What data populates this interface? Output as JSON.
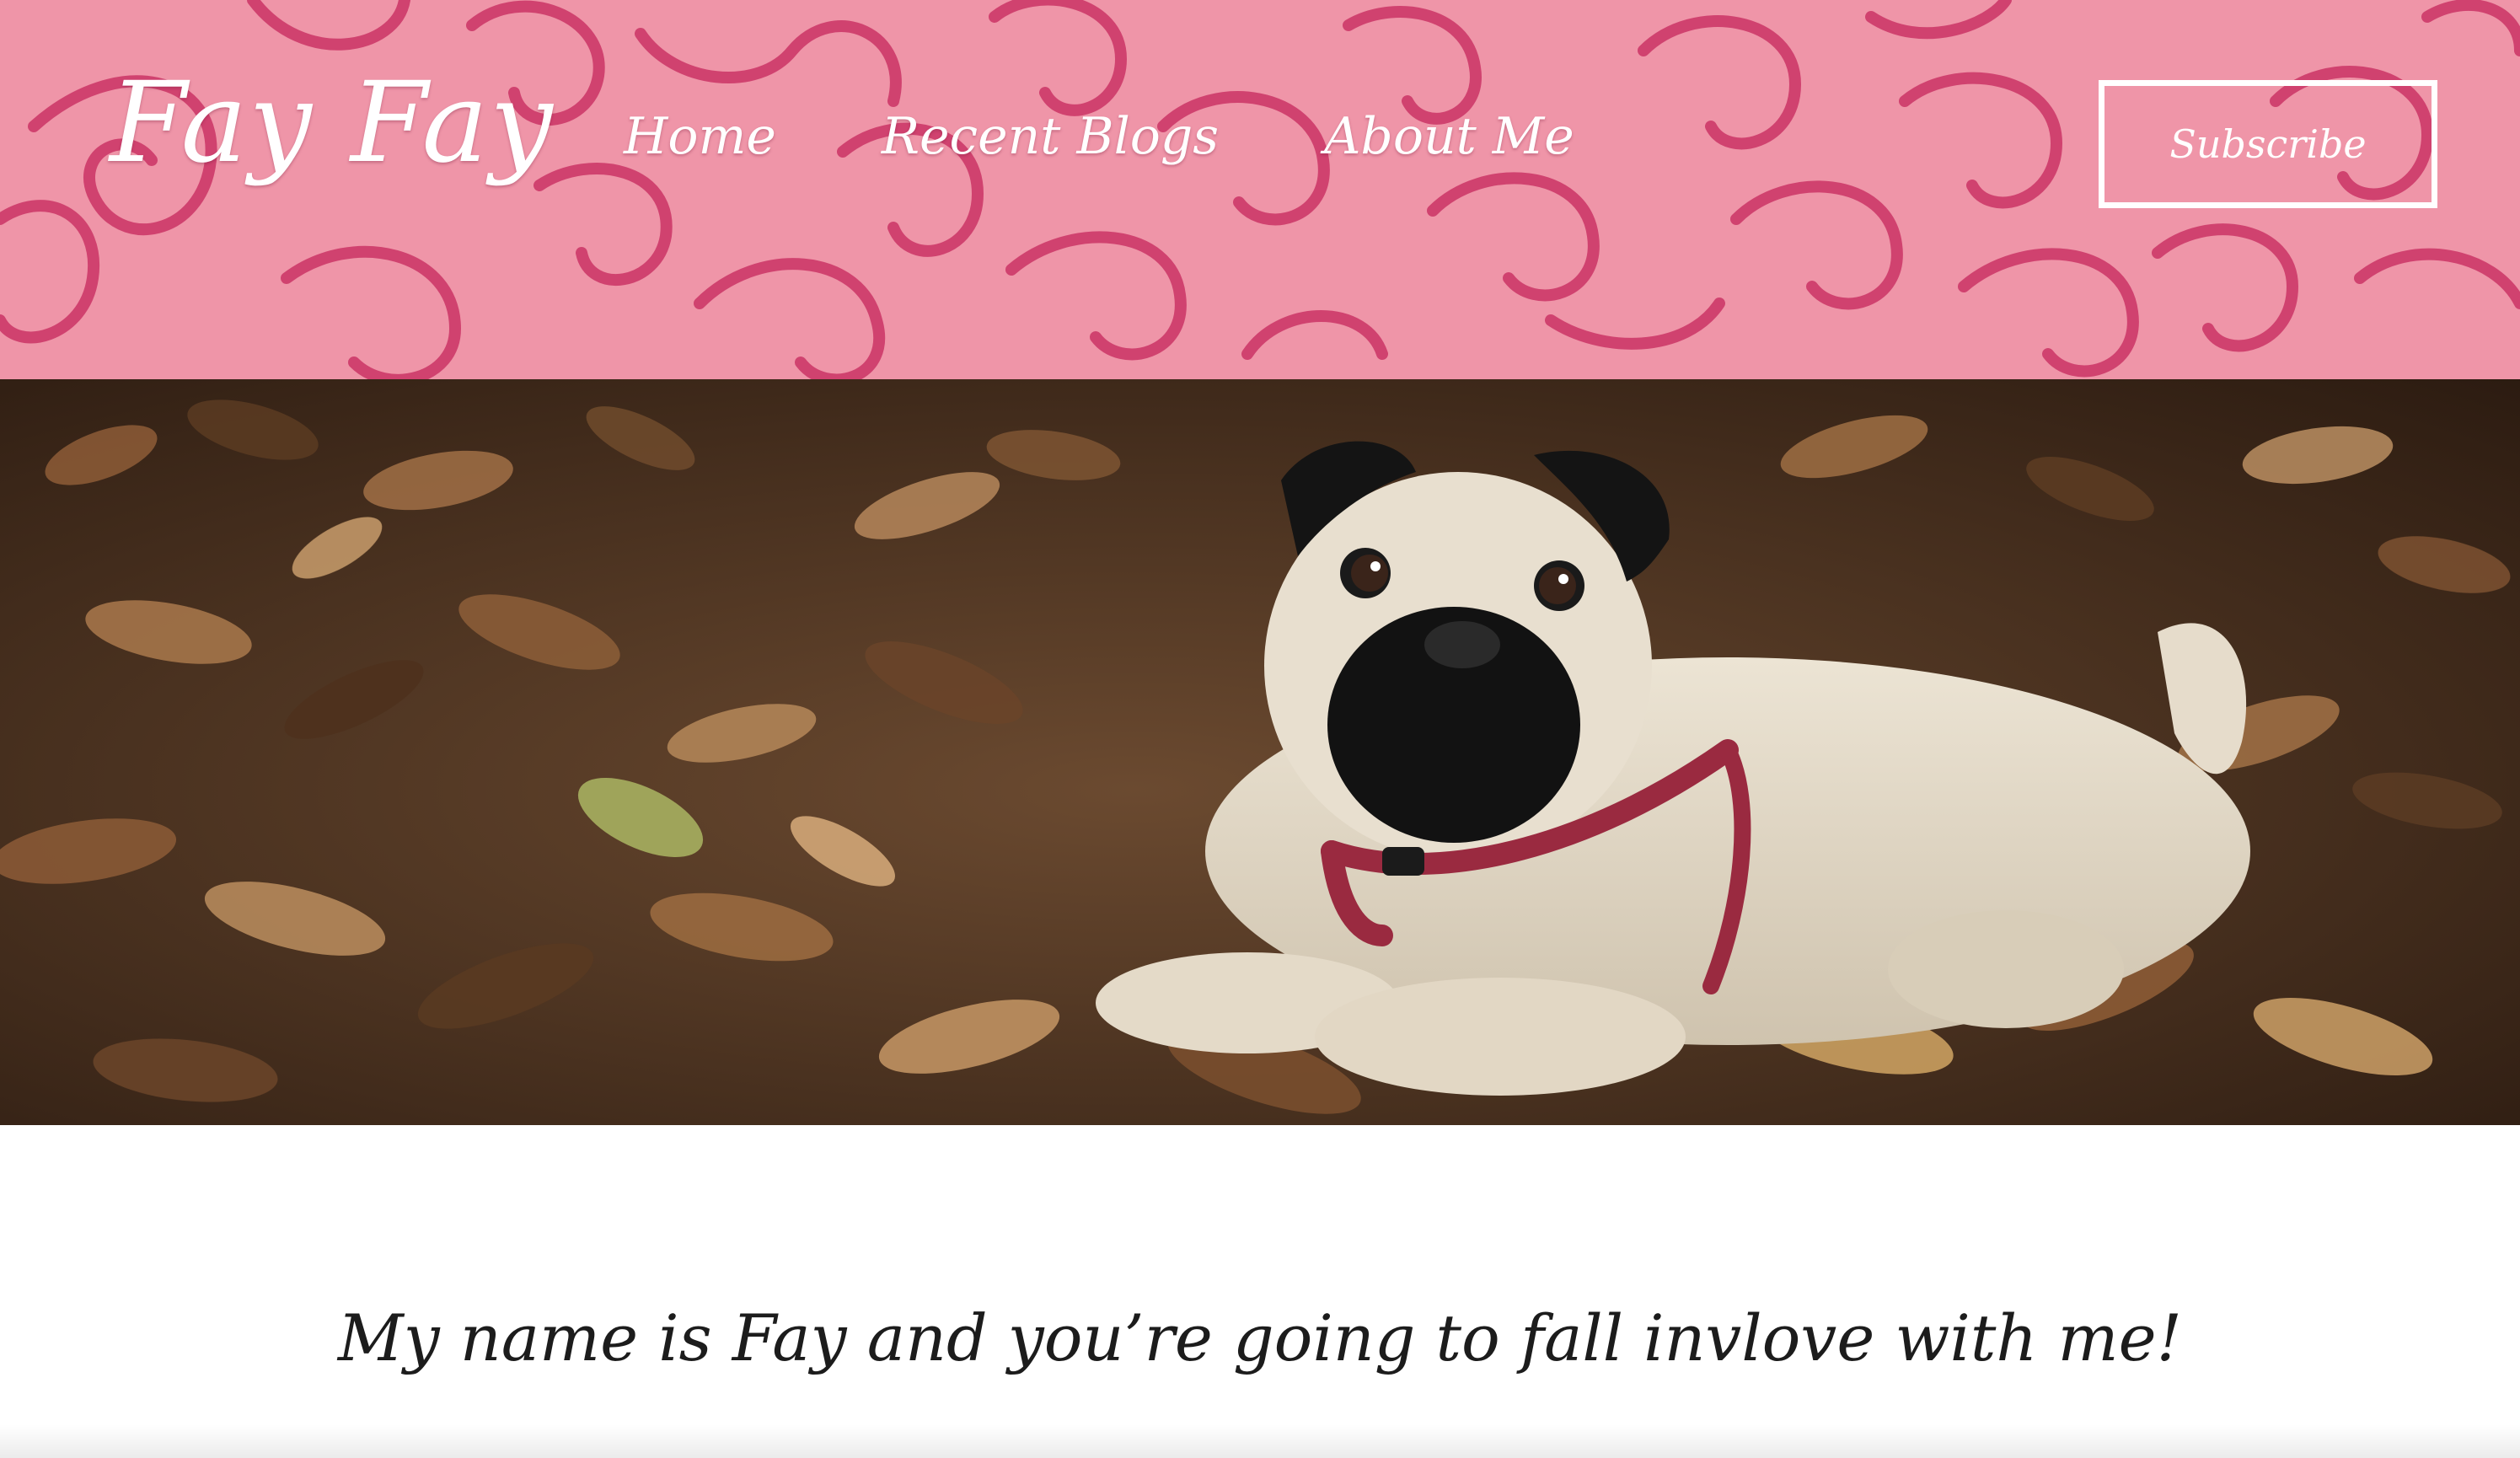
{
  "site": {
    "brand": "Fay Fay",
    "accent_color": "#ef95a8",
    "swirl_color": "#d0426f"
  },
  "nav": {
    "items": [
      {
        "label": "Home"
      },
      {
        "label": "Recent Blogs"
      },
      {
        "label": "About Me"
      }
    ]
  },
  "header": {
    "subscribe_label": "Subscribe"
  },
  "hero": {
    "image_icon": "pug-on-autumn-leaves-photo"
  },
  "intro": {
    "text": "My name is Fay and you’re going to fall invlove with me!"
  }
}
